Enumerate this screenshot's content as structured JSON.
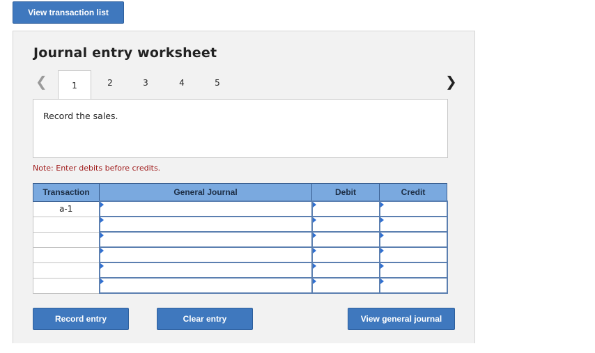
{
  "toolbar": {
    "view_transactions_label": "View transaction list"
  },
  "worksheet": {
    "title": "Journal entry worksheet",
    "tabs": [
      {
        "label": "1",
        "active": true
      },
      {
        "label": "2",
        "active": false
      },
      {
        "label": "3",
        "active": false
      },
      {
        "label": "4",
        "active": false
      },
      {
        "label": "5",
        "active": false
      }
    ],
    "nav_prev_icon": "chevron-left-icon",
    "nav_next_icon": "chevron-right-icon",
    "prompt": "Record the sales.",
    "note": "Note: Enter debits before credits."
  },
  "table": {
    "headers": {
      "transaction": "Transaction",
      "general_journal": "General Journal",
      "debit": "Debit",
      "credit": "Credit"
    },
    "rows": [
      {
        "transaction": "a-1",
        "account": "",
        "debit": "",
        "credit": ""
      },
      {
        "transaction": "",
        "account": "",
        "debit": "",
        "credit": ""
      },
      {
        "transaction": "",
        "account": "",
        "debit": "",
        "credit": ""
      },
      {
        "transaction": "",
        "account": "",
        "debit": "",
        "credit": ""
      },
      {
        "transaction": "",
        "account": "",
        "debit": "",
        "credit": ""
      },
      {
        "transaction": "",
        "account": "",
        "debit": "",
        "credit": ""
      }
    ]
  },
  "actions": {
    "record_entry": "Record entry",
    "clear_entry": "Clear entry",
    "view_general_journal": "View general journal"
  },
  "colors": {
    "button": "#3f78be",
    "header": "#7aa9df",
    "note": "#a01c1c"
  }
}
